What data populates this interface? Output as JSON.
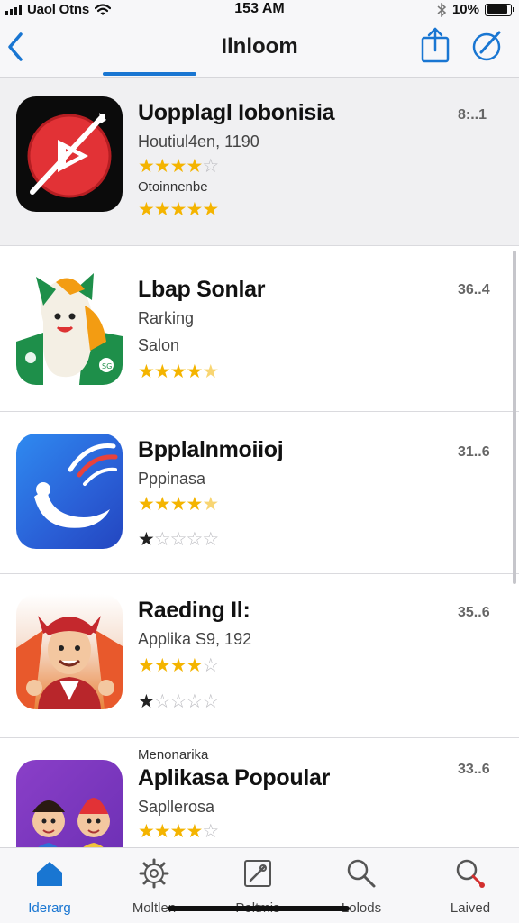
{
  "status_bar": {
    "carrier": "Uaol Otns",
    "time": "153 AM",
    "battery_percent": "10%",
    "battery_level": 0.9
  },
  "nav": {
    "title": "Ilnloom",
    "back_icon": "chevron-left-icon",
    "share_icon": "share-icon",
    "compose_icon": "compose-icon",
    "accent_color": "#1976d2"
  },
  "apps": [
    {
      "name": "Uopplagl Iobonisia",
      "subtitle": "Houtiul4en, 1190",
      "subtitle2": "Otoinnenbe",
      "size": "8:..1",
      "rating1": 4,
      "rating2": 5
    },
    {
      "name": "Lbap Sonlar",
      "subtitle": "Rarking",
      "subtitle2": "Salon",
      "size": "36..4",
      "rating1": 4.5
    },
    {
      "name": "Bpplalnmoiioj",
      "subtitle": "Pppinasa",
      "size": "31..6",
      "rating1": 4.5,
      "rating2": 1
    },
    {
      "name": "Raeding Il:",
      "subtitle": "Applika S9, 192",
      "size": "35..6",
      "rating1": 4,
      "rating2": 1
    },
    {
      "pretitle": "Menonarika",
      "name": "Aplikasa Popoular",
      "subtitle": "Sapllerosa",
      "size": "33..6",
      "rating1": 4
    }
  ],
  "tabs": [
    {
      "label": "Iderarg",
      "icon": "home-icon",
      "active": true
    },
    {
      "label": "Moltlen",
      "icon": "gear-icon",
      "active": false
    },
    {
      "label": "Poltmis",
      "icon": "edit-icon",
      "active": false
    },
    {
      "label": "Lolods",
      "icon": "search-icon",
      "active": false
    },
    {
      "label": "Laived",
      "icon": "search-red-icon",
      "active": false
    }
  ]
}
